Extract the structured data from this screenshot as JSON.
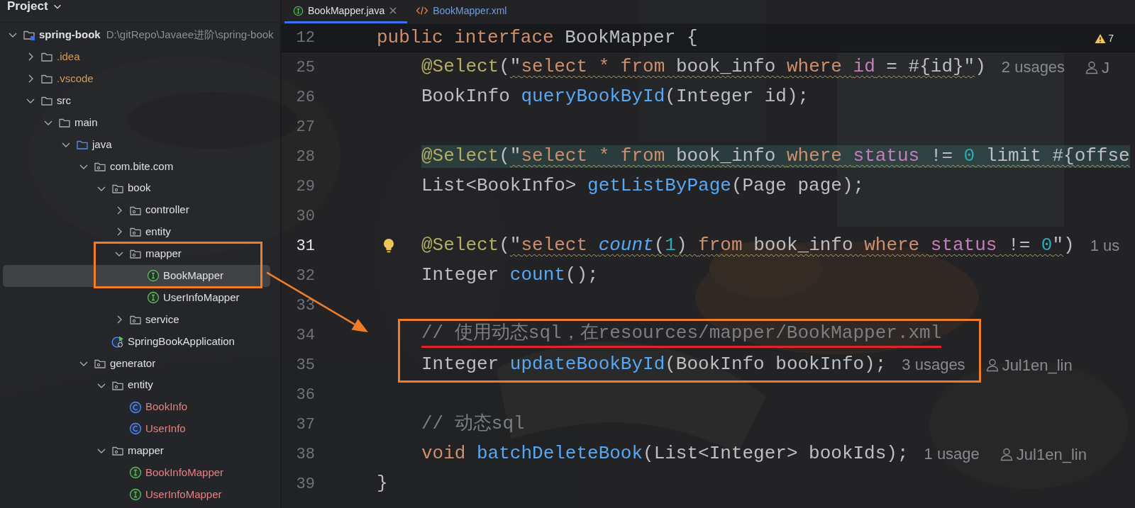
{
  "project_panel": {
    "title": "Project",
    "tree": [
      {
        "kind": "module",
        "name": "spring-book",
        "path": "D:\\gitRepo\\Javaee进阶\\spring-book",
        "color": "#dfe1e5",
        "expanded": true,
        "selected": false,
        "framed": false,
        "children": [
          {
            "kind": "folder",
            "name": ".idea",
            "color": "#d39a5c",
            "expanded": false,
            "selected": false,
            "framed": false
          },
          {
            "kind": "folder",
            "name": ".vscode",
            "color": "#d39a5c",
            "expanded": false,
            "selected": false,
            "framed": false
          },
          {
            "kind": "folder",
            "name": "src",
            "color": "#dfe1e5",
            "expanded": true,
            "selected": false,
            "framed": false,
            "children": [
              {
                "kind": "folder",
                "name": "main",
                "color": "#dfe1e5",
                "expanded": true,
                "selected": false,
                "framed": false,
                "children": [
                  {
                    "kind": "source-root",
                    "name": "java",
                    "color": "#dfe1e5",
                    "expanded": true,
                    "selected": false,
                    "framed": false,
                    "children": [
                      {
                        "kind": "package",
                        "name": "com.bite.com",
                        "color": "#dfe1e5",
                        "expanded": true,
                        "selected": false,
                        "framed": false,
                        "children": [
                          {
                            "kind": "package",
                            "name": "book",
                            "color": "#dfe1e5",
                            "expanded": true,
                            "selected": false,
                            "framed": false,
                            "children": [
                              {
                                "kind": "package",
                                "name": "controller",
                                "color": "#dfe1e5",
                                "expanded": false,
                                "selected": false,
                                "framed": false
                              },
                              {
                                "kind": "package",
                                "name": "entity",
                                "color": "#dfe1e5",
                                "expanded": false,
                                "selected": false,
                                "framed": false
                              },
                              {
                                "kind": "package",
                                "name": "mapper",
                                "color": "#dfe1e5",
                                "expanded": true,
                                "selected": false,
                                "framed": true,
                                "children": [
                                  {
                                    "kind": "interface",
                                    "name": "BookMapper",
                                    "color": "#dfe1e5",
                                    "selected": true,
                                    "framed": true
                                  },
                                  {
                                    "kind": "interface",
                                    "name": "UserInfoMapper",
                                    "color": "#dfe1e5",
                                    "selected": false,
                                    "framed": false
                                  }
                                ]
                              },
                              {
                                "kind": "package",
                                "name": "service",
                                "color": "#dfe1e5",
                                "expanded": false,
                                "selected": false,
                                "framed": false
                              }
                            ]
                          },
                          {
                            "kind": "app",
                            "name": "SpringBookApplication",
                            "color": "#dfe1e5",
                            "selected": false,
                            "framed": false
                          }
                        ]
                      },
                      {
                        "kind": "package",
                        "name": "generator",
                        "color": "#dfe1e5",
                        "expanded": true,
                        "selected": false,
                        "framed": false,
                        "children": [
                          {
                            "kind": "package",
                            "name": "entity",
                            "color": "#dfe1e5",
                            "expanded": true,
                            "selected": false,
                            "framed": false,
                            "children": [
                              {
                                "kind": "class",
                                "name": "BookInfo",
                                "color": "#e88080",
                                "selected": false,
                                "framed": false
                              },
                              {
                                "kind": "class",
                                "name": "UserInfo",
                                "color": "#e88080",
                                "selected": false,
                                "framed": false
                              }
                            ]
                          },
                          {
                            "kind": "package",
                            "name": "mapper",
                            "color": "#dfe1e5",
                            "expanded": true,
                            "selected": false,
                            "framed": false,
                            "children": [
                              {
                                "kind": "interface",
                                "name": "BookInfoMapper",
                                "color": "#e88080",
                                "selected": false,
                                "framed": false
                              },
                              {
                                "kind": "interface",
                                "name": "UserInfoMapper",
                                "color": "#e88080",
                                "selected": false,
                                "framed": false
                              }
                            ]
                          }
                        ]
                      }
                    ]
                  }
                ]
              }
            ]
          }
        ]
      }
    ]
  },
  "editor": {
    "tabs": [
      {
        "label": "BookMapper.java",
        "kind": "java-interface",
        "color": "#dfe1e5",
        "selected": true,
        "closable": true
      },
      {
        "label": "BookMapper.xml",
        "kind": "xml",
        "color": "#6f9be0",
        "selected": false,
        "closable": false
      }
    ],
    "warnings": "7",
    "sticky_line": {
      "number": "12",
      "tokens": [
        {
          "kind": "kw",
          "text": "public interface "
        },
        {
          "kind": "plain",
          "text": "BookMapper {"
        }
      ]
    },
    "lines": [
      {
        "number": "25",
        "indented": true,
        "sql_warning": true,
        "tokens": [
          {
            "kind": "ann",
            "text": "@Select"
          },
          {
            "kind": "plain",
            "text": "("
          },
          {
            "kind": "sql-plain",
            "text": "\""
          },
          {
            "kind": "sql-kw",
            "text": "select * from"
          },
          {
            "kind": "sql-plain",
            "text": " book_info "
          },
          {
            "kind": "sql-kw",
            "text": "where "
          },
          {
            "kind": "sql-col",
            "text": "id"
          },
          {
            "kind": "sql-plain",
            "text": " = #{id}\""
          },
          {
            "kind": "plain",
            "text": ")"
          }
        ],
        "usages": "2 usages",
        "author": "J"
      },
      {
        "number": "26",
        "indented": true,
        "tokens": [
          {
            "kind": "plain",
            "text": "BookInfo "
          },
          {
            "kind": "method",
            "text": "queryBookById"
          },
          {
            "kind": "plain",
            "text": "(Integer id);"
          }
        ]
      },
      {
        "number": "27"
      },
      {
        "number": "28",
        "indented": true,
        "highlighted": true,
        "sql_warning": true,
        "tokens": [
          {
            "kind": "ann",
            "text": "@Select"
          },
          {
            "kind": "plain",
            "text": "("
          },
          {
            "kind": "sql-plain",
            "text": "\""
          },
          {
            "kind": "sql-kw",
            "text": "select * from"
          },
          {
            "kind": "sql-plain",
            "text": " book_info "
          },
          {
            "kind": "sql-kw",
            "text": "where "
          },
          {
            "kind": "sql-col",
            "text": "status"
          },
          {
            "kind": "sql-plain",
            "text": " != "
          },
          {
            "kind": "sql-num",
            "text": "0"
          },
          {
            "kind": "sql-plain",
            "text": " limit #{offse"
          }
        ]
      },
      {
        "number": "29",
        "indented": true,
        "tokens": [
          {
            "kind": "plain",
            "text": "List<BookInfo> "
          },
          {
            "kind": "method",
            "text": "getListByPage"
          },
          {
            "kind": "plain",
            "text": "(Page page);"
          }
        ]
      },
      {
        "number": "30"
      },
      {
        "number": "31",
        "indented": true,
        "current": true,
        "intention_bulb": true,
        "sql_warning": true,
        "tokens": [
          {
            "kind": "ann",
            "text": "@Select"
          },
          {
            "kind": "plain",
            "text": "("
          },
          {
            "kind": "sql-plain",
            "text": "\""
          },
          {
            "kind": "sql-kw",
            "text": "select "
          },
          {
            "kind": "sql-fn",
            "text": "count"
          },
          {
            "kind": "sql-plain",
            "text": "("
          },
          {
            "kind": "sql-num",
            "text": "1"
          },
          {
            "kind": "sql-plain",
            "text": ") "
          },
          {
            "kind": "sql-kw",
            "text": "from"
          },
          {
            "kind": "sql-plain",
            "text": " book_info "
          },
          {
            "kind": "sql-kw",
            "text": "where "
          },
          {
            "kind": "sql-col",
            "text": "status"
          },
          {
            "kind": "sql-plain",
            "text": " != "
          },
          {
            "kind": "sql-num",
            "text": "0"
          },
          {
            "kind": "sql-plain",
            "text": "\""
          },
          {
            "kind": "plain",
            "text": ")"
          }
        ],
        "usages": "1 us"
      },
      {
        "number": "32",
        "indented": true,
        "tokens": [
          {
            "kind": "plain",
            "text": "Integer "
          },
          {
            "kind": "method",
            "text": "count"
          },
          {
            "kind": "plain",
            "text": "();"
          }
        ]
      },
      {
        "number": "33"
      },
      {
        "number": "34",
        "indented": true,
        "boxed": true,
        "underlined": true,
        "tokens": [
          {
            "kind": "comment",
            "text": "// 使用动态sql，在resources/mapper/BookMapper.xml"
          }
        ]
      },
      {
        "number": "35",
        "indented": true,
        "boxed": true,
        "tokens": [
          {
            "kind": "plain",
            "text": "Integer "
          },
          {
            "kind": "method",
            "text": "updateBookById"
          },
          {
            "kind": "plain",
            "text": "(BookInfo bookInfo);"
          }
        ],
        "usages": "3 usages",
        "author": "Jul1en_lin"
      },
      {
        "number": "36"
      },
      {
        "number": "37",
        "indented": true,
        "tokens": [
          {
            "kind": "comment",
            "text": "// 动态sql"
          }
        ]
      },
      {
        "number": "38",
        "indented": true,
        "tokens": [
          {
            "kind": "kw",
            "text": "void "
          },
          {
            "kind": "method",
            "text": "batchDeleteBook"
          },
          {
            "kind": "plain",
            "text": "(List<Integer> bookIds);"
          }
        ],
        "usages": "1 usage",
        "author": "Jul1en_lin"
      },
      {
        "number": "39",
        "tokens": [
          {
            "kind": "plain",
            "text": "}"
          }
        ]
      }
    ]
  },
  "annotation_arrow": true
}
